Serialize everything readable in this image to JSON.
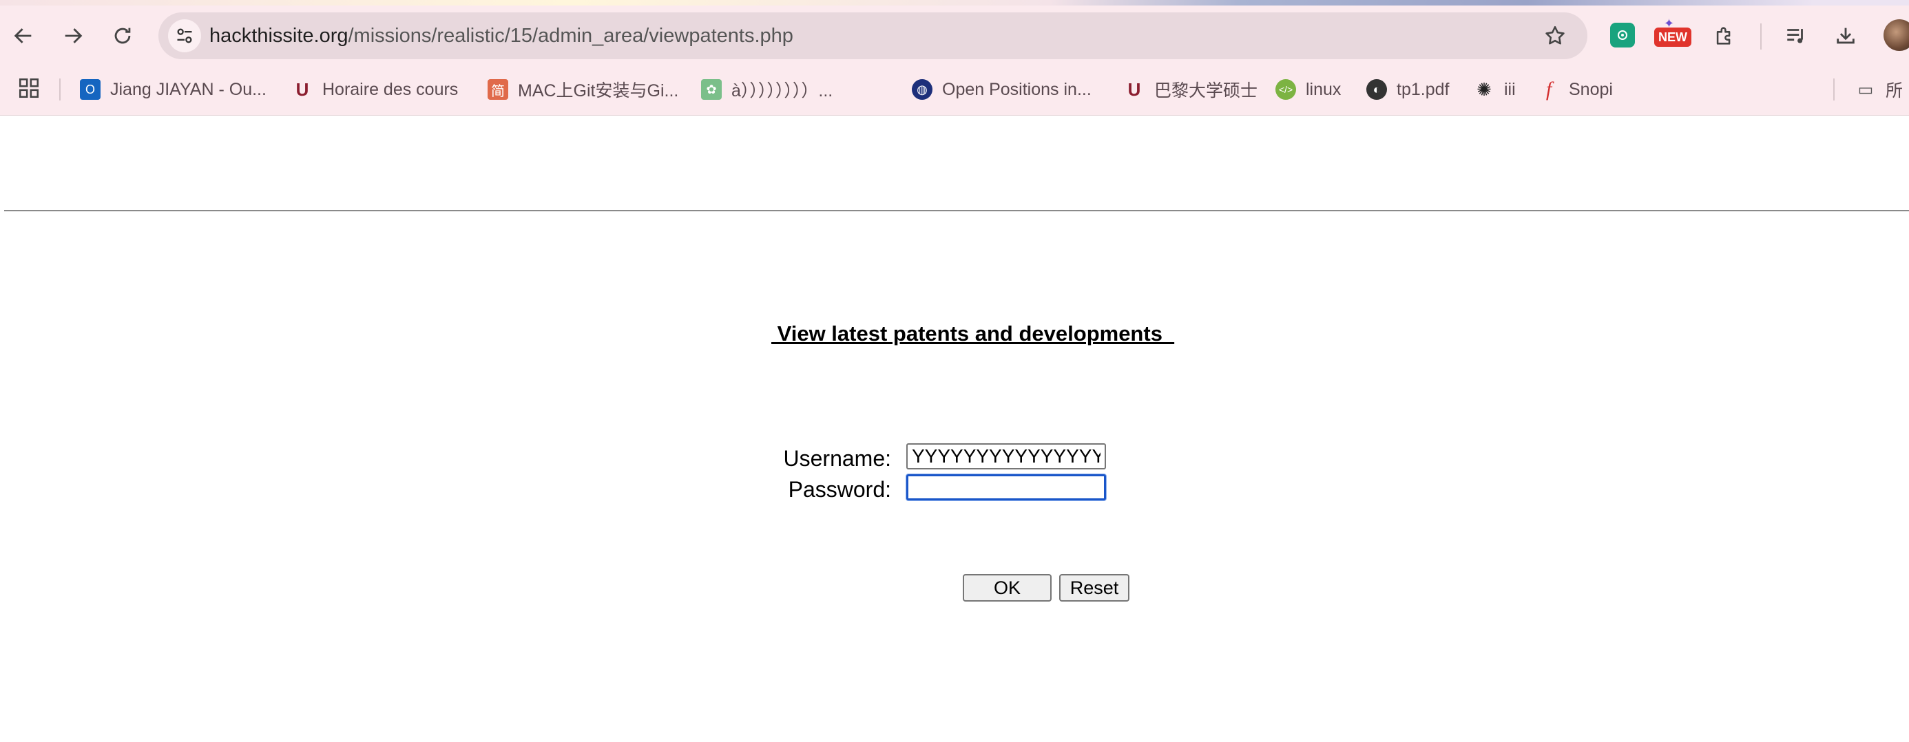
{
  "browser": {
    "url_host": "hackthissite.org",
    "url_path": "/missions/realistic/15/admin_area/viewpatents.php",
    "extension_badge": "NEW",
    "bookmarks": [
      {
        "label": "Jiang JIAYAN - Ou...",
        "icon": "outlook-icon",
        "color": "#1565c0"
      },
      {
        "label": "Horaire des cours",
        "icon": "university-logo-icon",
        "color": "#8b1e2f"
      },
      {
        "label": "MAC上Git安装与Gi...",
        "icon": "jianshu-icon",
        "color": "#e06a4a"
      },
      {
        "label": "à））））））））...",
        "icon": "paw-icon",
        "color": "#7bbf8a"
      },
      {
        "label": "Open Positions in...",
        "icon": "globe-icon",
        "color": "#1d2f7a"
      },
      {
        "label": "巴黎大学硕士",
        "icon": "university-logo-icon",
        "color": "#8b1e2f"
      },
      {
        "label": "linux",
        "icon": "linux-icon",
        "color": "#7cb342"
      },
      {
        "label": "tp1.pdf",
        "icon": "web-globe-icon",
        "color": "#333333"
      },
      {
        "label": "iii",
        "icon": "openai-icon",
        "color": "#222222"
      },
      {
        "label": "Snopi",
        "icon": "snopi-f-icon",
        "color": "#d32f2f"
      },
      {
        "label": "所",
        "icon": "folder-icon",
        "color": "#555555"
      }
    ]
  },
  "page": {
    "title": " View latest patents and developments  ",
    "username_label": "Username:",
    "password_label": "Password:",
    "username_value": "YYYYYYYYYYYYYYYYY",
    "password_value": "",
    "ok_label": "OK",
    "reset_label": "Reset"
  }
}
